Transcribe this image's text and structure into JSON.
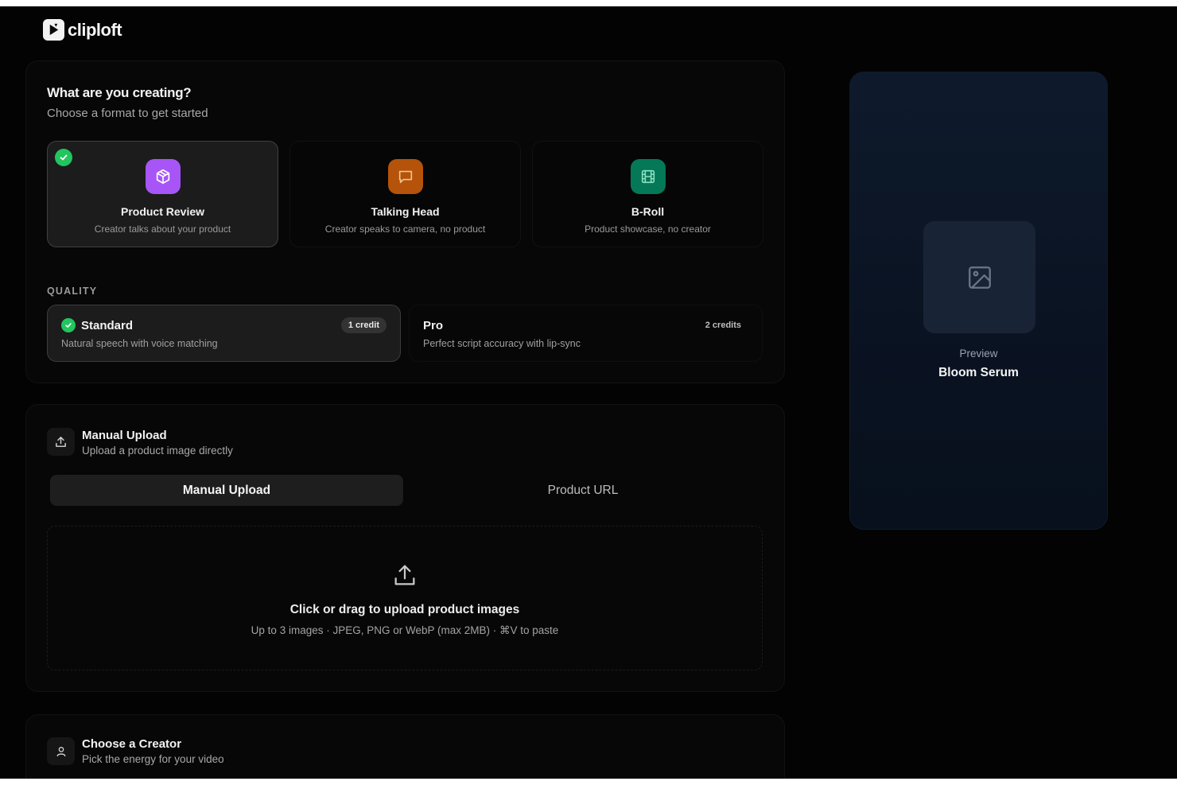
{
  "brand": {
    "name": "cliploft"
  },
  "format_section": {
    "title": "What are you creating?",
    "subtitle": "Choose a format to get started",
    "formats": [
      {
        "name": "Product Review",
        "desc": "Creator talks about your product",
        "icon": "box-icon",
        "color": "#a855f7",
        "selected": true
      },
      {
        "name": "Talking Head",
        "desc": "Creator speaks to camera, no product",
        "icon": "message-square-icon",
        "color": "#b45309",
        "selected": false
      },
      {
        "name": "B-Roll",
        "desc": "Product showcase, no creator",
        "icon": "film-icon",
        "color": "#047857",
        "selected": false
      }
    ]
  },
  "quality": {
    "label": "QUALITY",
    "options": [
      {
        "name": "Standard",
        "desc": "Natural speech with voice matching",
        "credits": "1 credit",
        "selected": true
      },
      {
        "name": "Pro",
        "desc": "Perfect script accuracy with lip-sync",
        "credits": "2 credits",
        "selected": false
      }
    ]
  },
  "source": {
    "title": "Manual Upload",
    "subtitle": "Upload a product image directly",
    "tabs": [
      "Manual Upload",
      "Product URL"
    ],
    "active_tab": "Manual Upload",
    "dropzone": {
      "title": "Click or drag to upload product images",
      "hint": "Up to 3 images · JPEG, PNG or WebP (max 2MB) · ⌘V to paste"
    }
  },
  "creator": {
    "title": "Choose a Creator",
    "subtitle": "Pick the energy for your video"
  },
  "preview": {
    "label": "Preview",
    "product_name": "Bloom Serum"
  }
}
